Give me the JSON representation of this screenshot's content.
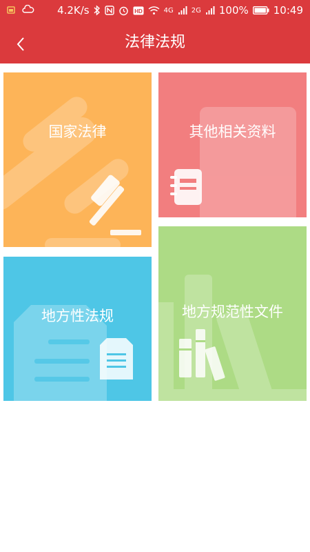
{
  "status_bar": {
    "net_speed": "4.2K/s",
    "signal_4g": "4G",
    "signal_2g": "2G",
    "battery": "100%",
    "time": "10:49"
  },
  "header": {
    "title": "法律法规"
  },
  "tiles": [
    {
      "label": "国家法律",
      "color": "#fdb458"
    },
    {
      "label": "其他相关资料",
      "color": "#f27e7f"
    },
    {
      "label": "地方性法规",
      "color": "#4ec6e6"
    },
    {
      "label": "地方规范性文件",
      "color": "#addb85"
    }
  ],
  "colors": {
    "header_bg": "#db3a3d",
    "page_bg": "#ffffff"
  }
}
